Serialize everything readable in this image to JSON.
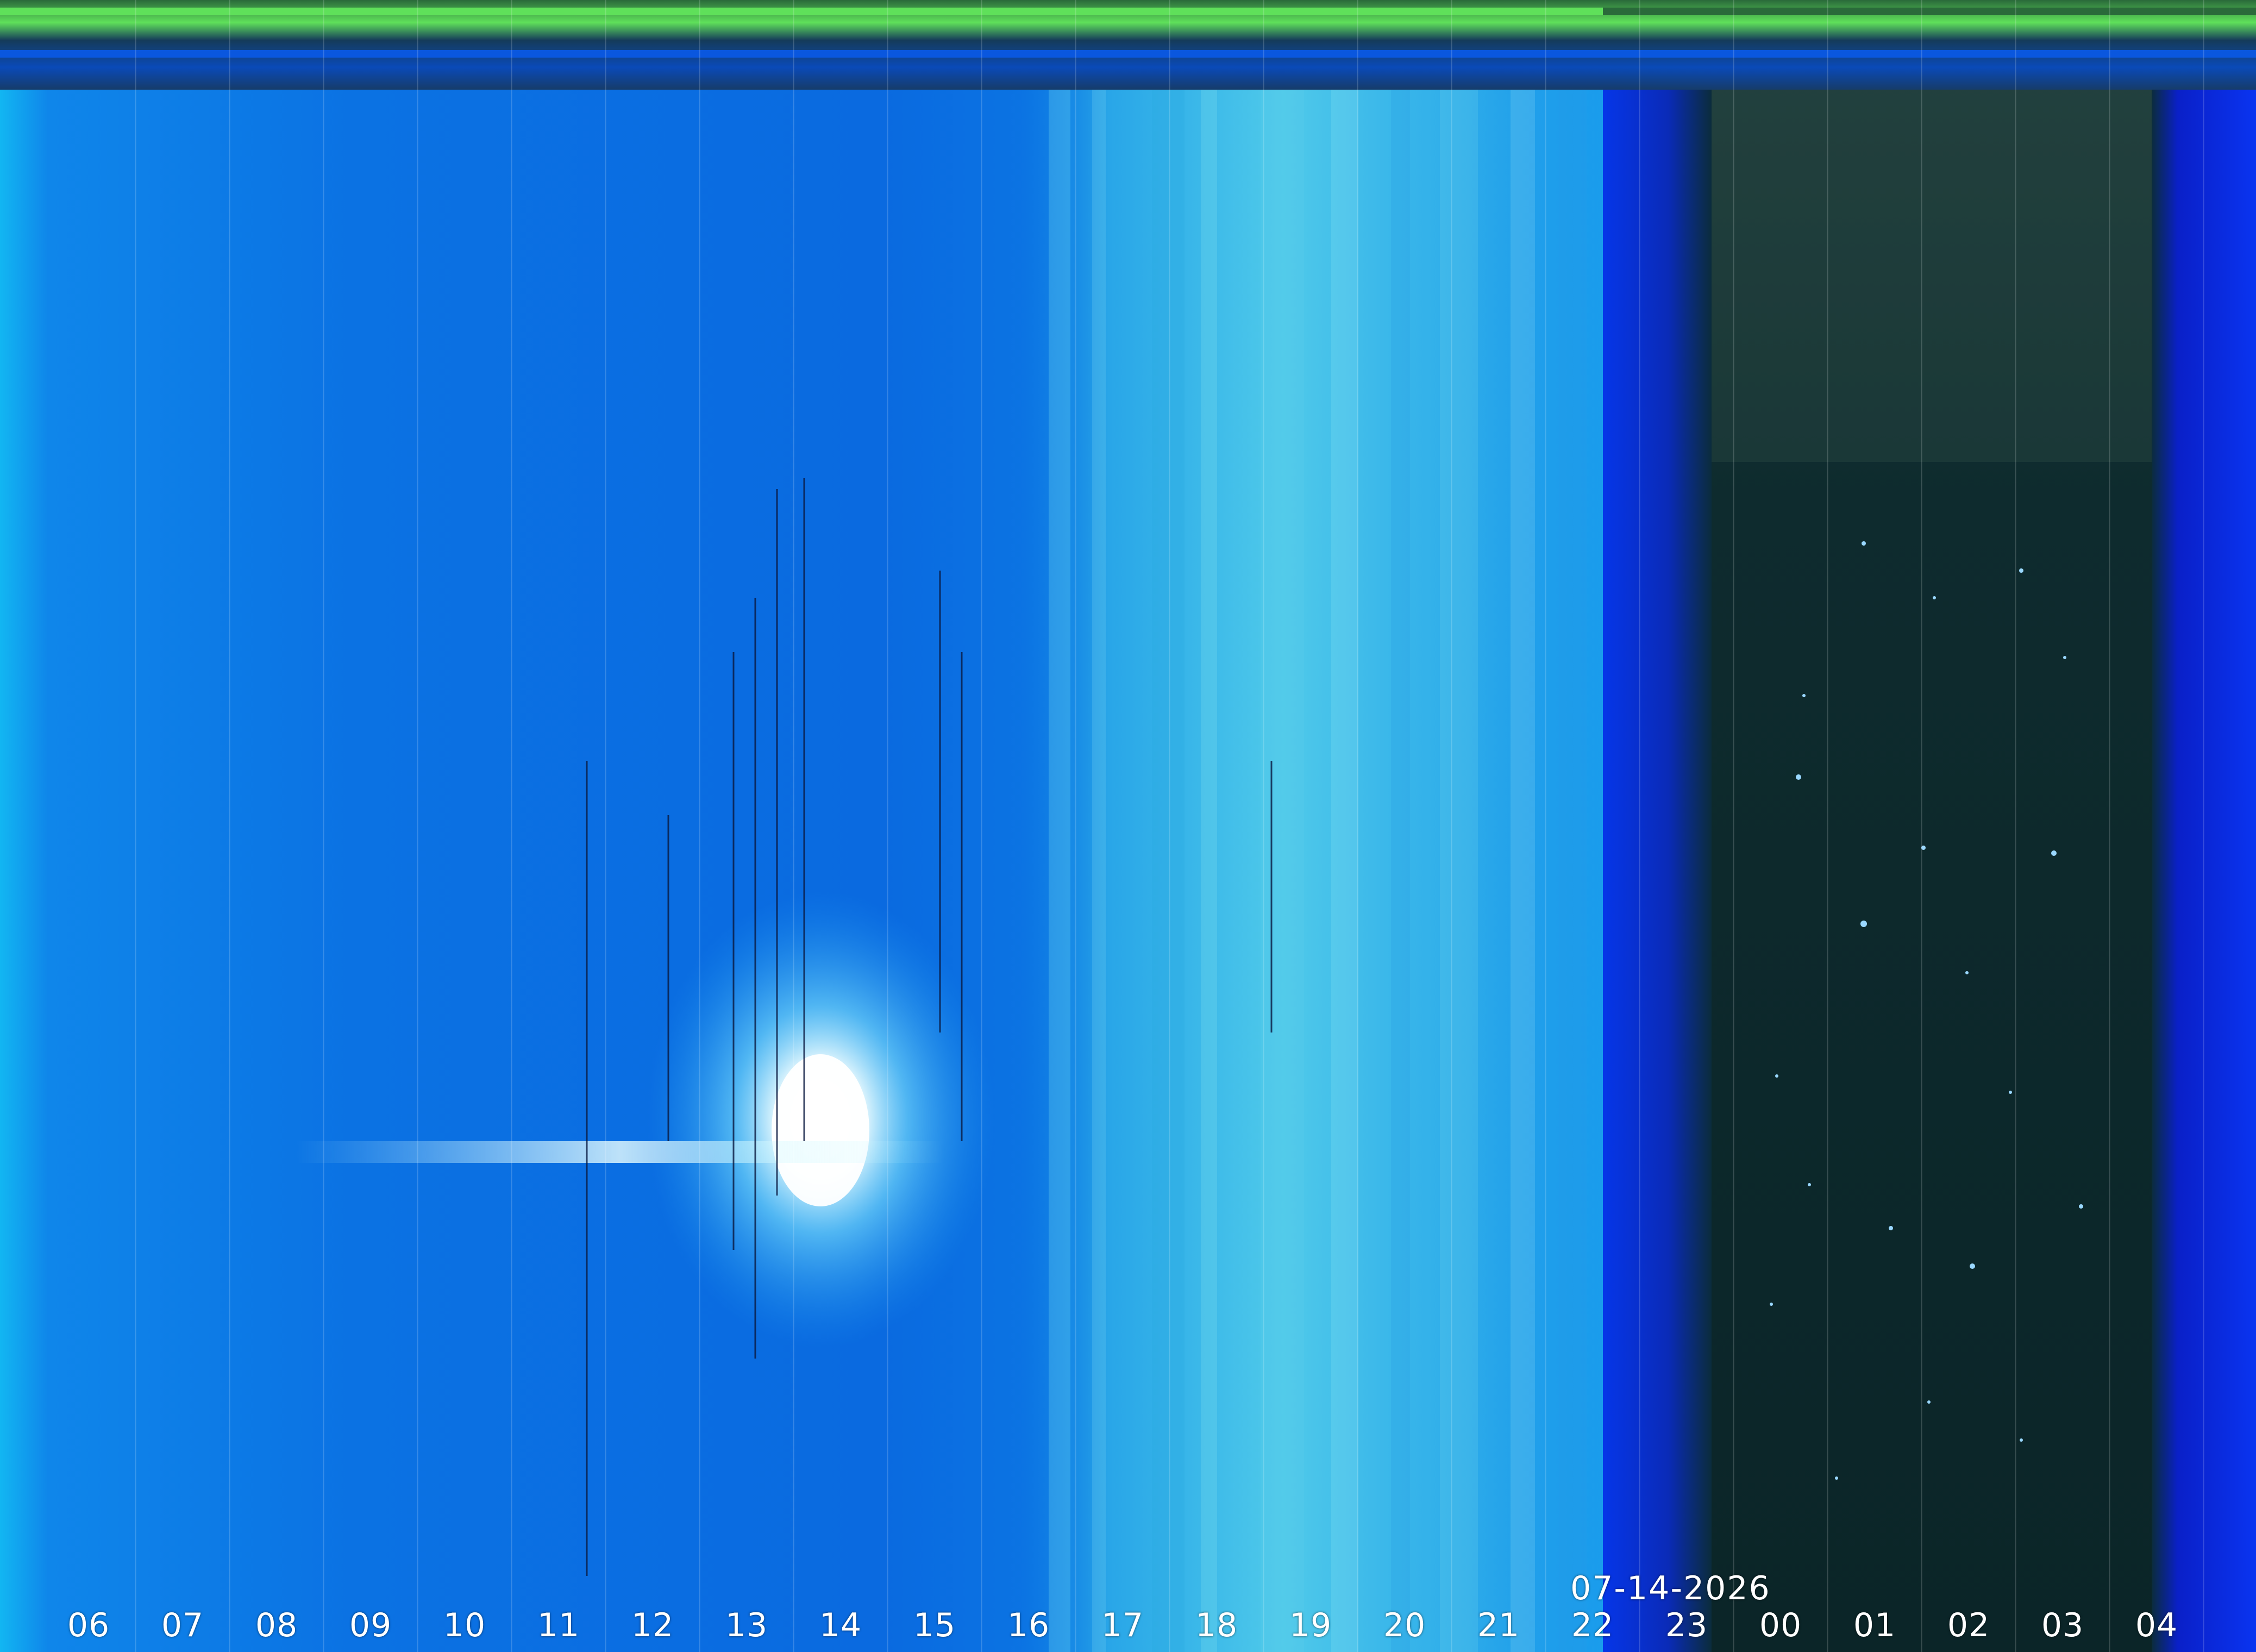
{
  "keogram": {
    "date": "07-14-2026",
    "hour_labels": [
      "06",
      "07",
      "08",
      "09",
      "10",
      "11",
      "12",
      "13",
      "14",
      "15",
      "16",
      "17",
      "18",
      "19",
      "20",
      "21",
      "22",
      "23",
      "00",
      "01",
      "02",
      "03",
      "04"
    ],
    "colors": {
      "day_sky": "#0a6fe0",
      "bright_sky": "#1a9cf0",
      "cloud_cyan": "#59d8ee",
      "twilight_blue": "#0c2fe0",
      "night_sky": "#0c2a2c",
      "header_green": "#5fe05a",
      "sun": "#ffffff"
    }
  }
}
